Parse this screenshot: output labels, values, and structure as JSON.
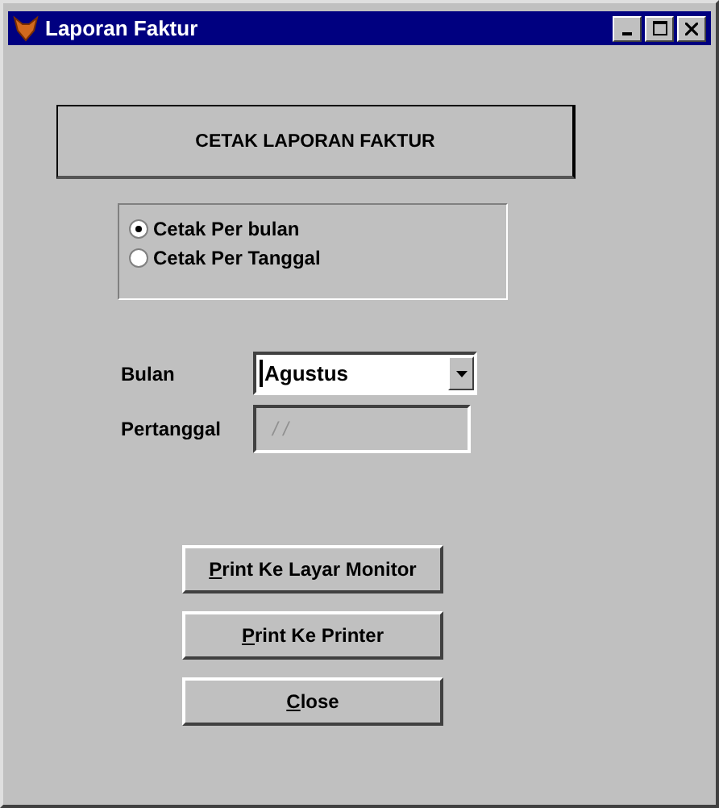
{
  "window": {
    "title": "Laporan Faktur"
  },
  "heading": "CETAK LAPORAN FAKTUR",
  "options": [
    {
      "label": "Cetak Per bulan",
      "selected": true
    },
    {
      "label": "Cetak Per Tanggal",
      "selected": false
    }
  ],
  "fields": [
    {
      "kind": "select",
      "label": "Bulan",
      "value": "Agustus",
      "disabled": false
    },
    {
      "kind": "text",
      "label": "Pertanggal",
      "value": "/ /",
      "disabled": true
    }
  ],
  "buttons": [
    {
      "label": "Print Ke Layar Monitor"
    },
    {
      "label": "Print Ke Printer"
    },
    {
      "label": "Close"
    }
  ]
}
